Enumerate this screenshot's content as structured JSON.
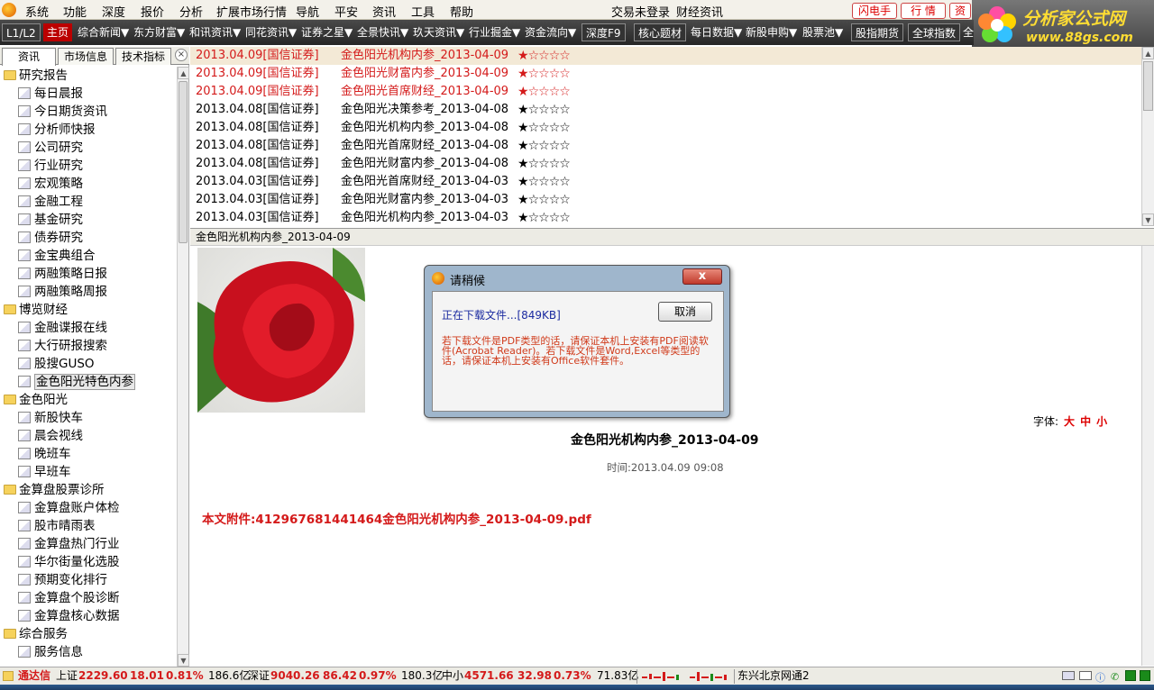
{
  "menubar": {
    "items": [
      "系统",
      "功能",
      "深度",
      "报价",
      "分析",
      "扩展市场行情",
      "导航",
      "平安",
      "资讯",
      "工具",
      "帮助"
    ],
    "login": "交易未登录",
    "news": "财经资讯",
    "buttons": [
      "闪电手",
      "行 情",
      "资"
    ]
  },
  "brand": {
    "name": "分析家公式网",
    "url": "www.88gs.com"
  },
  "toolbar": {
    "level": "L1/L2",
    "home": "主页",
    "links": [
      "综合新闻▼",
      "东方财富▼",
      "和讯资讯▼",
      "同花资讯▼",
      "证券之星▼",
      "全景快讯▼",
      "玖天资讯▼",
      "行业掘金▼",
      "资金流向▼"
    ],
    "boxed": [
      "深度F9",
      "核心题材",
      "每日数据▼",
      "新股申购▼",
      "股票池▼",
      "股指期货",
      "全球指数",
      "全"
    ]
  },
  "panel": {
    "tabs": [
      "资讯",
      "市场信息",
      "技术指标"
    ],
    "close": "×",
    "tree": [
      {
        "type": "folder",
        "label": "研究报告"
      },
      {
        "type": "leaf",
        "label": "每日晨报"
      },
      {
        "type": "leaf",
        "label": "今日期货资讯"
      },
      {
        "type": "leaf",
        "label": "分析师快报"
      },
      {
        "type": "leaf",
        "label": "公司研究"
      },
      {
        "type": "leaf",
        "label": "行业研究"
      },
      {
        "type": "leaf",
        "label": "宏观策略"
      },
      {
        "type": "leaf",
        "label": "金融工程"
      },
      {
        "type": "leaf",
        "label": "基金研究"
      },
      {
        "type": "leaf",
        "label": "债券研究"
      },
      {
        "type": "leaf",
        "label": "金宝典组合"
      },
      {
        "type": "leaf",
        "label": "两融策略日报"
      },
      {
        "type": "leaf",
        "label": "两融策略周报"
      },
      {
        "type": "folder",
        "label": "博览财经"
      },
      {
        "type": "leaf",
        "label": "金融谍报在线"
      },
      {
        "type": "leaf",
        "label": "大行研报搜索"
      },
      {
        "type": "leaf",
        "label": "股搜GUSO"
      },
      {
        "type": "leaf",
        "label": "金色阳光特色内参",
        "selected": true
      },
      {
        "type": "folder",
        "label": "金色阳光"
      },
      {
        "type": "leaf",
        "label": "新股快车"
      },
      {
        "type": "leaf",
        "label": "晨会视线"
      },
      {
        "type": "leaf",
        "label": "晚班车"
      },
      {
        "type": "leaf",
        "label": "早班车"
      },
      {
        "type": "folder",
        "label": "金算盘股票诊所"
      },
      {
        "type": "leaf",
        "label": "金算盘账户体检"
      },
      {
        "type": "leaf",
        "label": "股市晴雨表"
      },
      {
        "type": "leaf",
        "label": "金算盘热门行业"
      },
      {
        "type": "leaf",
        "label": "华尔街量化选股"
      },
      {
        "type": "leaf",
        "label": "预期变化排行"
      },
      {
        "type": "leaf",
        "label": "金算盘个股诊断"
      },
      {
        "type": "leaf",
        "label": "金算盘核心数据"
      },
      {
        "type": "folder",
        "label": "综合服务"
      },
      {
        "type": "leaf",
        "label": "服务信息"
      }
    ]
  },
  "news": {
    "rows": [
      {
        "date": "2013.04.09[国信证券]",
        "title": "金色阳光机构内参_2013-04-09",
        "stars": 1,
        "red": true,
        "active": true
      },
      {
        "date": "2013.04.09[国信证券]",
        "title": "金色阳光财富内参_2013-04-09",
        "stars": 1,
        "red": true
      },
      {
        "date": "2013.04.09[国信证券]",
        "title": "金色阳光首席财经_2013-04-09",
        "stars": 1,
        "red": true
      },
      {
        "date": "2013.04.08[国信证券]",
        "title": "金色阳光决策参考_2013-04-08",
        "stars": 1
      },
      {
        "date": "2013.04.08[国信证券]",
        "title": "金色阳光机构内参_2013-04-08",
        "stars": 1
      },
      {
        "date": "2013.04.08[国信证券]",
        "title": "金色阳光首席财经_2013-04-08",
        "stars": 1
      },
      {
        "date": "2013.04.08[国信证券]",
        "title": "金色阳光财富内参_2013-04-08",
        "stars": 1
      },
      {
        "date": "2013.04.03[国信证券]",
        "title": "金色阳光首席财经_2013-04-03",
        "stars": 1
      },
      {
        "date": "2013.04.03[国信证券]",
        "title": "金色阳光财富内参_2013-04-03",
        "stars": 1
      },
      {
        "date": "2013.04.03[国信证券]",
        "title": "金色阳光机构内参_2013-04-03",
        "stars": 1
      }
    ]
  },
  "content": {
    "bar_title": "金色阳光机构内参_2013-04-09",
    "font_label": "字体:",
    "font_sizes": [
      "大",
      "中",
      "小"
    ],
    "title": "金色阳光机构内参_2013-04-09",
    "time": "时间:2013.04.09 09:08",
    "attachment": "本文附件:412967681441464金色阳光机构内参_2013-04-09.pdf"
  },
  "dialog": {
    "title": "请稍候",
    "close": "x",
    "status": "正在下载文件...[849KB]",
    "cancel": "取消",
    "note": "若下载文件是PDF类型的话，请保证本机上安装有PDF阅读软件(Acrobat Reader)。若下载文件是Word,Excel等类型的话，请保证本机上安装有Office软件套件。"
  },
  "status": {
    "brand": "通达信",
    "sh_label": "上证",
    "sh_value": "2229.60",
    "sh_chg": "18.01",
    "sh_pct": "0.81%",
    "sh_amt": "186.6亿",
    "sz_label": "深证",
    "sz_value": "9040.26",
    "sz_chg": "86.42",
    "sz_pct": "0.97%",
    "sz_amt": "180.3亿",
    "zx_label": "中小",
    "zx_value": "4571.66",
    "zx_chg": "32.98",
    "zx_pct": "0.73%",
    "zx_amt": "71.83亿",
    "server": "东兴北京网通2"
  },
  "colors": {
    "accent_red": "#d41a1a",
    "toolbar_bg": "#2e2e2e",
    "brand_yellow": "#ffdd33"
  }
}
